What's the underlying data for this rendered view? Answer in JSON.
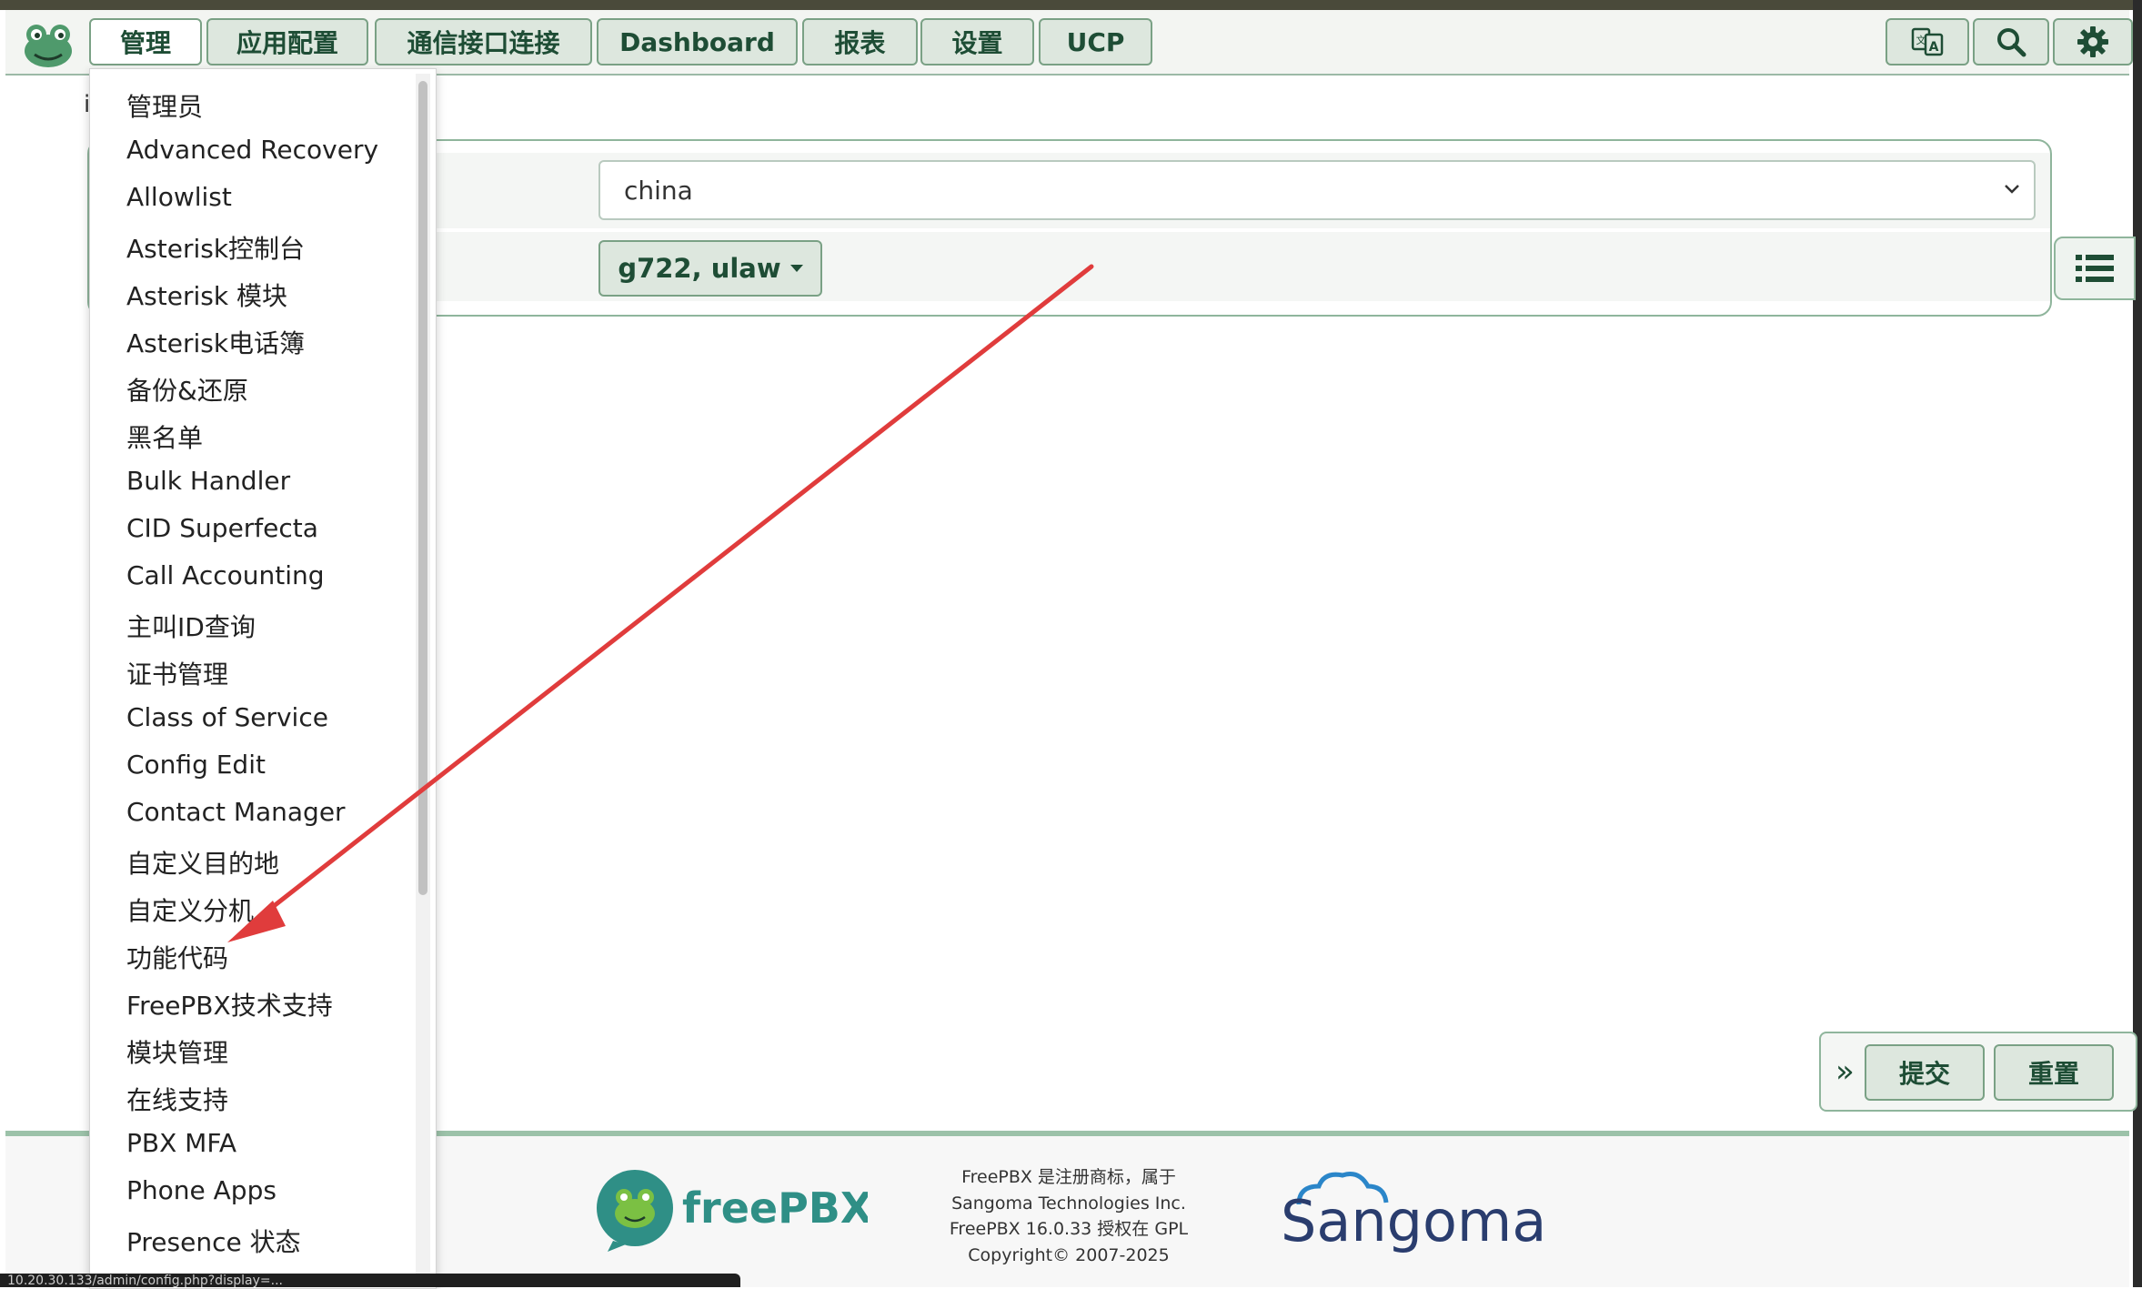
{
  "nav": {
    "items": [
      "管理",
      "应用配置",
      "通信接口连接",
      "Dashboard",
      "报表",
      "设置",
      "UCP"
    ]
  },
  "page": {
    "country_select_value": "china",
    "codec_button_label": "g722, ulaw",
    "title_fragment": "i"
  },
  "actions": {
    "submit_label": "提交",
    "reset_label": "重置",
    "expand_glyph": "»"
  },
  "dropdown": {
    "items": [
      "管理员",
      "Advanced Recovery",
      "Allowlist",
      "Asterisk控制台",
      "Asterisk 模块",
      "Asterisk电话簿",
      "备份&还原",
      "黑名单",
      "Bulk Handler",
      "CID Superfecta",
      "Call Accounting",
      "主叫ID查询",
      "证书管理",
      "Class of Service",
      "Config Edit",
      "Contact Manager",
      "自定义目的地",
      "自定义分机",
      "功能代码",
      "FreePBX技术支持",
      "模块管理",
      "在线支持",
      "PBX MFA",
      "Phone Apps",
      "Presence 状态"
    ]
  },
  "footer": {
    "freepbx_logo_text": "freePBX",
    "lines": [
      "FreePBX 是注册商标，属于",
      "Sangoma Technologies Inc.",
      "FreePBX 16.0.33 授权在 GPL",
      "Copyright© 2007-2025"
    ],
    "sangoma_logo_text": "Sangoma"
  },
  "statusbar": {
    "text": "10.20.30.133/admin/config.php?display=..."
  },
  "colors": {
    "accent_green": "#1e4d35",
    "button_fill": "#dde7de",
    "border_green": "#7aa185",
    "annotation_arrow": "#e03c3c"
  },
  "icons": [
    "freepbx-frog-icon",
    "translate-icon",
    "search-icon",
    "gear-icon",
    "list-icon",
    "chevron-down-icon"
  ]
}
